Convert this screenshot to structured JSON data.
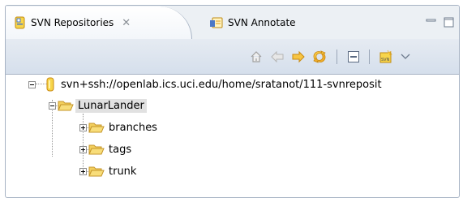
{
  "tabs": [
    {
      "label": "SVN Repositories",
      "icon": "repository-icon",
      "active": true,
      "close_glyph": "✕"
    },
    {
      "label": "SVN Annotate",
      "icon": "annotate-icon",
      "active": false
    }
  ],
  "window_controls": [
    "minimize-icon",
    "maximize-icon"
  ],
  "toolbar": [
    "home-icon",
    "back-arrow-icon",
    "forward-arrow-icon",
    "refresh-icon",
    "collapse-all-icon",
    "new-repository-location-icon",
    "view-menu-icon"
  ],
  "tree": {
    "repository": {
      "label": "svn+ssh://openlab.ics.uci.edu/home/sratanot/111-svnreposit",
      "expanded": true
    },
    "project": {
      "label": "LunarLander",
      "expanded": true,
      "selected": true
    },
    "folders": [
      {
        "label": "branches",
        "expanded": false
      },
      {
        "label": "tags",
        "expanded": false
      },
      {
        "label": "trunk",
        "expanded": false
      }
    ]
  },
  "colors": {
    "folder": "#f2c94c",
    "selection": "#e1e1e1",
    "toolbar_arrow": "#f0b42e"
  }
}
